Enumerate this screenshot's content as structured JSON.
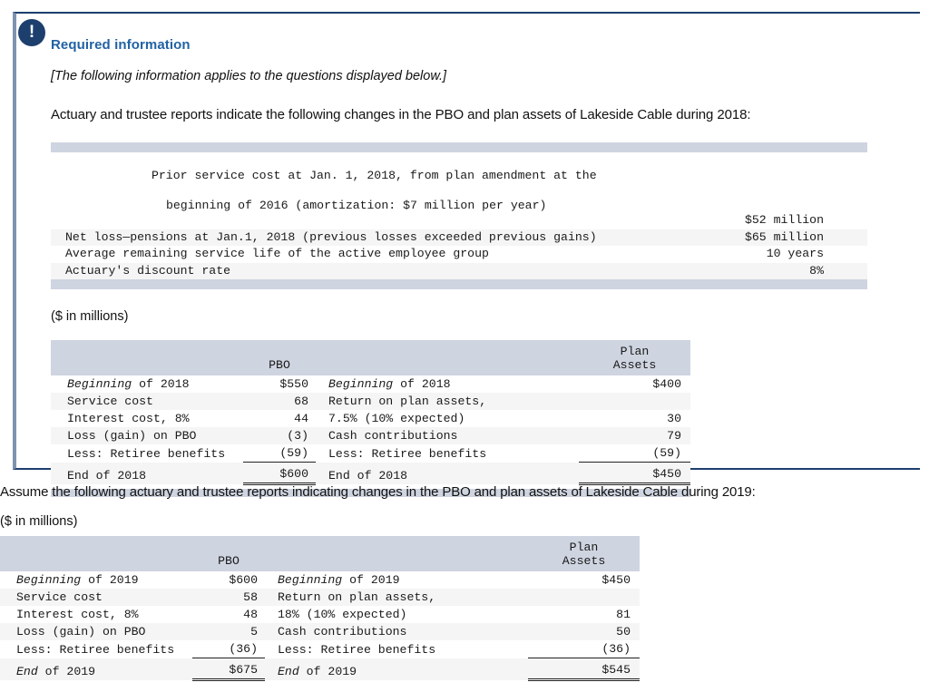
{
  "card": {
    "badge_icon": "exclamation-icon",
    "badge_glyph": "!",
    "title": "Required information",
    "note": "[The following information applies to the questions displayed below.]",
    "lead": "Actuary and trustee reports indicate the following changes in the PBO and plan assets of Lakeside Cable during 2018:",
    "units_label": "($ in millions)",
    "accent_color": "#1d3f6e",
    "title_color": "#2162a4",
    "header_band_color": "#ced4e0"
  },
  "info_table": {
    "rows": [
      {
        "label": "Prior service cost at Jan. 1, 2018, from plan amendment at the",
        "label2": "beginning of 2016 (amortization: $7 million per year)",
        "value": "$52 million"
      },
      {
        "label": "Net loss—pensions at Jan.1, 2018 (previous losses exceeded previous gains)",
        "value": "$65 million"
      },
      {
        "label": "Average remaining service life of the active employee group",
        "value": "10 years"
      },
      {
        "label": "Actuary's discount rate",
        "value": "8%"
      }
    ]
  },
  "table_2018": {
    "header": {
      "pbo": "PBO",
      "plan_line1": "Plan",
      "plan_line2": "Assets"
    },
    "pbo_rows": [
      {
        "label_italic": "Beginning",
        "label_rest": " of 2018",
        "value": "$550"
      },
      {
        "label_italic": "",
        "label_rest": "Service cost",
        "value": "68"
      },
      {
        "label_italic": "",
        "label_rest": "Interest cost, 8%",
        "value": "44"
      },
      {
        "label_italic": "",
        "label_rest": "Loss (gain) on PBO",
        "value": "(3)"
      },
      {
        "label_italic": "",
        "label_rest": "Less: Retiree benefits",
        "value": "(59)"
      }
    ],
    "pbo_total": {
      "label": "End of 2018",
      "value": "$600"
    },
    "plan_rows": [
      {
        "label_italic": "Beginning",
        "label_rest": " of 2018",
        "value": "$400"
      },
      {
        "label_italic": "",
        "label_rest": "Return on plan assets,",
        "value": ""
      },
      {
        "label_italic": "",
        "label_rest": "7.5% (10% expected)",
        "value": "30"
      },
      {
        "label_italic": "",
        "label_rest": "Cash contributions",
        "value": "79"
      },
      {
        "label_italic": "",
        "label_rest": "Less: Retiree benefits",
        "value": "(59)"
      }
    ],
    "plan_total": {
      "label": "End of 2018",
      "value": "$450"
    }
  },
  "second": {
    "assume_text": "Assume the following actuary and trustee reports indicating changes in the PBO and plan assets of Lakeside Cable during 2019:",
    "units_label": "($ in millions)"
  },
  "table_2019": {
    "header": {
      "pbo": "PBO",
      "plan_line1": "Plan",
      "plan_line2": "Assets"
    },
    "pbo_rows": [
      {
        "label_italic": "Beginning",
        "label_rest": " of 2019",
        "value": "$600"
      },
      {
        "label_italic": "",
        "label_rest": "Service cost",
        "value": "58"
      },
      {
        "label_italic": "",
        "label_rest": "Interest cost, 8%",
        "value": "48"
      },
      {
        "label_italic": "",
        "label_rest": "Loss (gain) on PBO",
        "value": "5"
      },
      {
        "label_italic": "",
        "label_rest": "Less: Retiree benefits",
        "value": "(36)"
      }
    ],
    "pbo_total": {
      "label_italic": "End",
      "label_rest": " of 2019",
      "value": "$675"
    },
    "plan_rows": [
      {
        "label_italic": "Beginning",
        "label_rest": " of 2019",
        "value": "$450"
      },
      {
        "label_italic": "",
        "label_rest": "Return on plan assets,",
        "value": ""
      },
      {
        "label_italic": "",
        "label_rest": "18% (10% expected)",
        "value": "81"
      },
      {
        "label_italic": "",
        "label_rest": "Cash contributions",
        "value": "50"
      },
      {
        "label_italic": "",
        "label_rest": "Less: Retiree benefits",
        "value": "(36)"
      }
    ],
    "plan_total": {
      "label_italic": "End",
      "label_rest": " of 2019",
      "value": "$545"
    }
  }
}
